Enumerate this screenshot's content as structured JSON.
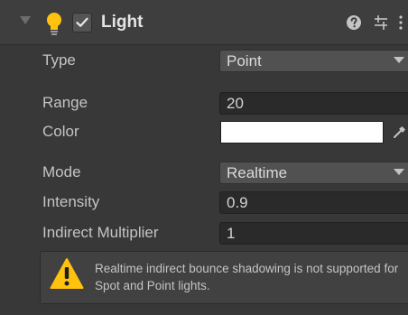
{
  "component": {
    "title": "Light",
    "enabled": true,
    "icon": "bulb-icon",
    "header_icons": [
      "help-icon",
      "preset-icon",
      "menu-icon"
    ]
  },
  "fields": {
    "type": {
      "label": "Type",
      "value": "Point"
    },
    "range": {
      "label": "Range",
      "value": "20"
    },
    "color": {
      "label": "Color",
      "value": "#ffffff"
    },
    "mode": {
      "label": "Mode",
      "value": "Realtime"
    },
    "intensity": {
      "label": "Intensity",
      "value": "0.9"
    },
    "indirect_multiplier": {
      "label": "Indirect Multiplier",
      "value": "1"
    }
  },
  "warning": {
    "icon": "warning-icon",
    "text": "Realtime indirect bounce shadowing is not supported for Spot and Point lights."
  },
  "colors": {
    "panel_background": "#383838",
    "header_background": "#3e3e3e",
    "field_background": "#2a2a2a",
    "dropdown_background": "#515151",
    "label_text": "#c4c4c4",
    "warning_yellow": "#ffc20e"
  }
}
